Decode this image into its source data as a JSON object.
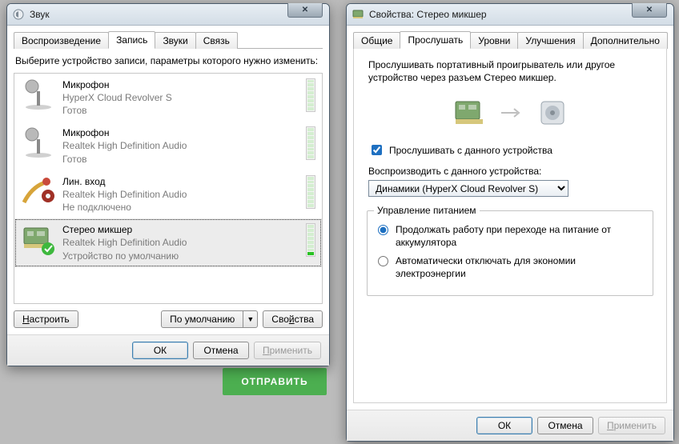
{
  "bg_button": "ОТПРАВИТЬ",
  "left": {
    "title": "Звук",
    "tabs": [
      "Воспроизведение",
      "Запись",
      "Звуки",
      "Связь"
    ],
    "active_tab": 1,
    "instr": "Выберите устройство записи, параметры которого нужно изменить:",
    "devices": [
      {
        "name": "Микрофон",
        "sub": "HyperX Cloud Revolver S",
        "status": "Готов",
        "icon": "mic-stand",
        "selected": false,
        "vu": 0
      },
      {
        "name": "Микрофон",
        "sub": "Realtek High Definition Audio",
        "status": "Готов",
        "icon": "mic-stand",
        "selected": false,
        "vu": 0
      },
      {
        "name": "Лин. вход",
        "sub": "Realtek High Definition Audio",
        "status": "Не подключено",
        "icon": "line-in",
        "selected": false,
        "vu": 0
      },
      {
        "name": "Стерео микшер",
        "sub": "Realtek High Definition Audio",
        "status": "Устройство по умолчанию",
        "icon": "mixer-card",
        "selected": true,
        "vu": 1
      }
    ],
    "btn_configure": "Настроить",
    "btn_default": "По умолчанию",
    "btn_props": "Свойства",
    "btn_ok": "ОК",
    "btn_cancel": "Отмена",
    "btn_apply": "Применить"
  },
  "right": {
    "title": "Свойства: Стерео микшер",
    "tabs": [
      "Общие",
      "Прослушать",
      "Уровни",
      "Улучшения",
      "Дополнительно"
    ],
    "active_tab": 1,
    "desc": "Прослушивать портативный проигрыватель или другое устройство через разъем Стерео микшер.",
    "chk_listen": "Прослушивать с данного устройства",
    "chk_listen_checked": true,
    "play_label": "Воспроизводить с данного устройства:",
    "play_selected": "Динамики (HyperX Cloud Revolver S)",
    "grp_power": "Управление питанием",
    "radio_continue": "Продолжать работу при переходе на питание от аккумулятора",
    "radio_auto": "Автоматически отключать для экономии электроэнергии",
    "radio_selected": 0,
    "btn_ok": "ОК",
    "btn_cancel": "Отмена",
    "btn_apply": "Применить"
  }
}
